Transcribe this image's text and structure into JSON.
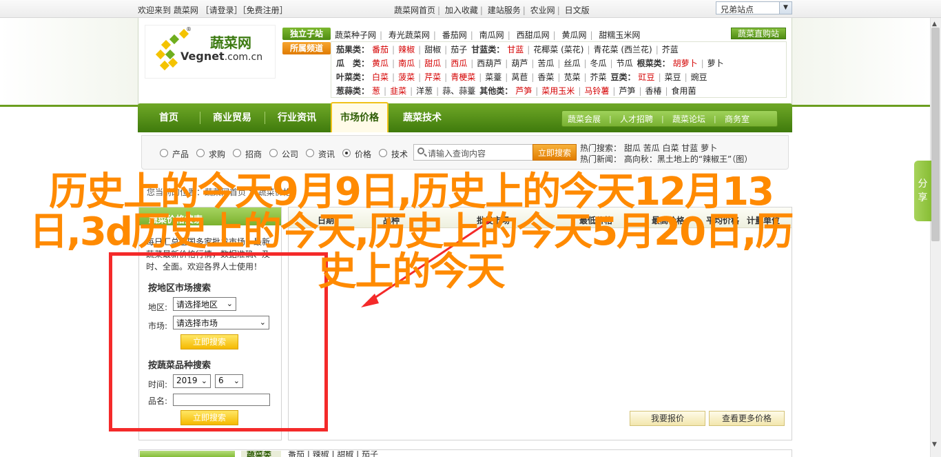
{
  "topbar": {
    "welcome": "欢迎来到 蔬菜网 ［请登录］［免费注册］",
    "links": [
      "蔬菜网首页",
      "加入收藏",
      "建站服务",
      "农业网",
      "日文版"
    ],
    "sister_sites": "兄弟站点"
  },
  "logo": {
    "cn": "蔬菜网",
    "en": "Vegnet",
    "domain": ".com.cn",
    "reg": "®"
  },
  "header": {
    "tag_independent": "独立子站",
    "tag_sub": "所属频道",
    "independent_links": [
      "蔬菜种子网",
      "寿光蔬菜网",
      "番茄网",
      "南瓜网",
      "西甜瓜网",
      "黄瓜网",
      "甜糯玉米网"
    ],
    "mall": "蔬菜直购站",
    "rows": [
      [
        {
          "t": "茄果类：",
          "lab": true
        },
        {
          "t": "番茄",
          "red": true
        },
        {
          "t": "辣椒",
          "red": true
        },
        {
          "t": "甜椒"
        },
        {
          "t": "茄子"
        },
        {
          "t": "甘蓝类：",
          "lab": true
        },
        {
          "t": "甘蓝",
          "red": true
        },
        {
          "t": "花椰菜 (菜花)"
        },
        {
          "t": "青花菜 (西兰花)"
        },
        {
          "t": "芥蓝"
        }
      ],
      [
        {
          "t": "瓜　类：",
          "lab": true
        },
        {
          "t": "黄瓜",
          "red": true
        },
        {
          "t": "南瓜",
          "red": true
        },
        {
          "t": "甜瓜",
          "red": true
        },
        {
          "t": "西瓜",
          "red": true
        },
        {
          "t": "西葫芦"
        },
        {
          "t": "葫芦"
        },
        {
          "t": "苦瓜"
        },
        {
          "t": "丝瓜"
        },
        {
          "t": "冬瓜"
        },
        {
          "t": "节瓜"
        },
        {
          "t": "根菜类：",
          "lab": true
        },
        {
          "t": "胡萝卜",
          "red": true
        },
        {
          "t": "萝卜"
        }
      ],
      [
        {
          "t": "叶菜类：",
          "lab": true
        },
        {
          "t": "白菜",
          "red": true
        },
        {
          "t": "菠菜",
          "red": true
        },
        {
          "t": "芹菜",
          "red": true
        },
        {
          "t": "青梗菜",
          "red": true
        },
        {
          "t": "菜薹"
        },
        {
          "t": "莴苣"
        },
        {
          "t": "香菜"
        },
        {
          "t": "苋菜"
        },
        {
          "t": "芥菜"
        },
        {
          "t": "豆类：",
          "lab": true
        },
        {
          "t": "豇豆",
          "red": true
        },
        {
          "t": "菜豆"
        },
        {
          "t": "豌豆"
        }
      ],
      [
        {
          "t": "葱蒜类：",
          "lab": true
        },
        {
          "t": "葱",
          "red": true
        },
        {
          "t": "韭菜",
          "red": true
        },
        {
          "t": "洋葱"
        },
        {
          "t": "蒜、蒜薹"
        },
        {
          "t": "其他类：",
          "lab": true
        },
        {
          "t": "芦笋",
          "red": false,
          "key": "x"
        },
        {
          "t": "菜用玉米",
          "red": true
        },
        {
          "t": "马铃薯",
          "red": true
        },
        {
          "t": "芦笋"
        },
        {
          "t": "香椿"
        },
        {
          "t": "食用菌"
        }
      ]
    ]
  },
  "mainnav": {
    "items": [
      "首页",
      "商业贸易",
      "行业资讯",
      "市场价格",
      "蔬菜技术"
    ],
    "sub": [
      "蔬菜会展",
      "人才招聘",
      "蔬菜论坛",
      "商务室"
    ]
  },
  "search": {
    "options": [
      "产品",
      "求购",
      "招商",
      "公司",
      "资讯",
      "价格",
      "技术"
    ],
    "placeholder": "请输入查询内容",
    "button": "立即搜索",
    "hot_search_label": "热门搜索：",
    "hot_search": "甜瓜 苦瓜 白菜 甘蓝 萝卜",
    "hot_news_label": "热门新闻：",
    "hot_news": "高向秋：黑土地上的“辣椒王”（图）"
  },
  "breadcrumb": "您当前的位置：蔬菜网首页 > 蔬菜价格",
  "left_panel": {
    "title": "蔬菜价格搜索",
    "intro": "每日汇总全国多家批发市场，最新蔬菜最新价格行情，数据准确、及时、全面。欢迎各界人士使用！",
    "region_section": "按地区市场搜索",
    "region_label": "地区:",
    "region_value": "请选择地区",
    "market_label": "市场:",
    "market_value": "请选择市场",
    "search_button": "立即搜索",
    "variety_section": "按蔬菜品种搜索",
    "time_label": "时间:",
    "year": "2019",
    "month": "6",
    "name_label": "品名:",
    "search_button2": "立即搜索"
  },
  "table": {
    "headers": [
      "日期",
      "品种",
      "批发市场",
      "最低价格",
      "最高价格",
      "平均价格",
      "计量单位"
    ],
    "quote_button": "我要报价",
    "more_button": "查看更多价格"
  },
  "bottom": {
    "tab": "蔬菜类",
    "links": "番茄 | 辣椒 | 甜椒 | 茄子"
  },
  "share": "分享",
  "overlay": {
    "title": "历史上的今天9月9日,历史上的今天12月13日,3d历史上的今天,历史上的今天5月20日,历史上的今天"
  },
  "colors": {
    "brand_green": "#5a9619",
    "accent_orange": "#ff8a00",
    "highlight_red": "#f42a2a"
  }
}
